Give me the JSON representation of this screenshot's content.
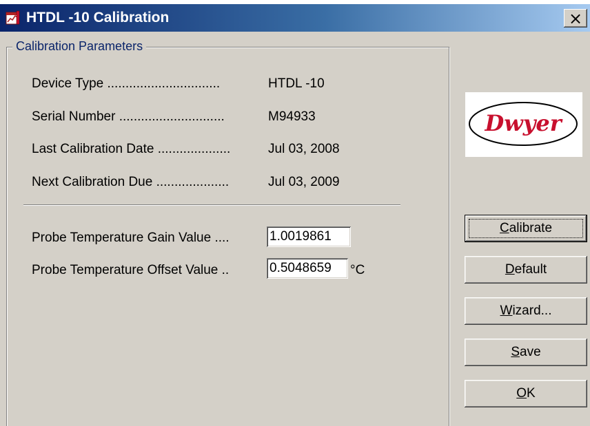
{
  "window": {
    "title": "HTDL -10 Calibration",
    "close_symbol": "×"
  },
  "group": {
    "legend": "Calibration Parameters"
  },
  "info": [
    {
      "label": "Device Type ...............................",
      "value": "HTDL -10"
    },
    {
      "label": "Serial Number .............................",
      "value": "M94933"
    },
    {
      "label": "Last Calibration Date ....................",
      "value": "Jul 03, 2008"
    },
    {
      "label": "Next Calibration Due ....................",
      "value": "Jul 03, 2009"
    }
  ],
  "fields": {
    "gain": {
      "label": "Probe Temperature Gain Value ....",
      "value": "1.0019861"
    },
    "offset": {
      "label": "Probe Temperature Offset Value ..",
      "value": "0.5048659",
      "unit": "°C"
    }
  },
  "logo": {
    "text": "Dwyer"
  },
  "buttons": {
    "calibrate": {
      "accel": "C",
      "rest": "alibrate"
    },
    "default": {
      "accel": "D",
      "rest": "efault"
    },
    "wizard": {
      "accel": "W",
      "rest": "izard..."
    },
    "save": {
      "accel": "S",
      "rest": "ave"
    },
    "ok": {
      "accel": "O",
      "rest": "K"
    }
  },
  "colors": {
    "title_gradient_start": "#0a246a",
    "title_gradient_end": "#a6caf0",
    "face": "#d4d0c8",
    "logo_red": "#c8102e"
  }
}
